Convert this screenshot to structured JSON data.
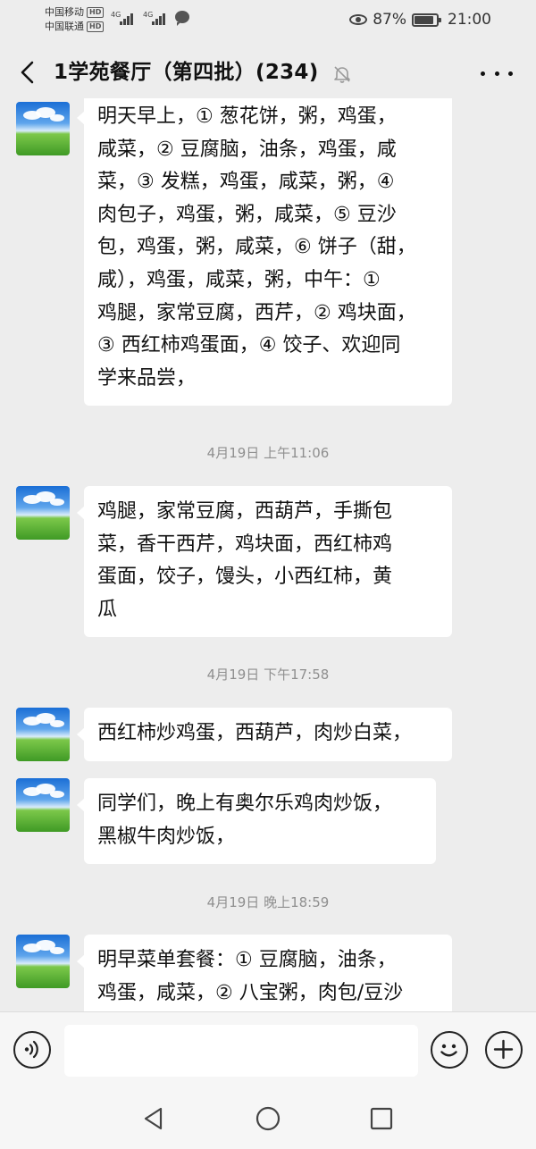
{
  "status_bar": {
    "carrier1": "中国移动",
    "carrier2": "中国联通",
    "hd1": "HD",
    "hd2": "HD",
    "net1": "4G",
    "net2": "4G",
    "battery_percent": "87%",
    "time": "21:00",
    "battery_level": 0.87
  },
  "header": {
    "title": "1学苑餐厅（第四批）(234)"
  },
  "messages": [
    {
      "type": "message",
      "lines": [
        "明天早上，① 葱花饼，粥，鸡蛋，",
        "咸菜，② 豆腐脑，油条，鸡蛋，咸",
        "菜，③ 发糕，鸡蛋，咸菜，粥，④",
        "肉包子，鸡蛋，粥，咸菜，⑤ 豆沙",
        "包，鸡蛋，粥，咸菜，⑥ 饼子（甜，",
        "咸），鸡蛋，咸菜，粥，中午：①",
        "鸡腿，家常豆腐，西芹，② 鸡块面，",
        "③ 西红柿鸡蛋面，④ 饺子、欢迎同",
        "学来品尝，"
      ]
    },
    {
      "type": "time",
      "text": "4月19日 上午11:06"
    },
    {
      "type": "message",
      "lines": [
        "鸡腿，家常豆腐，西葫芦，手撕包",
        "菜，香干西芹，鸡块面，西红柿鸡",
        "蛋面，饺子，馒头，小西红柿，黄",
        "瓜"
      ]
    },
    {
      "type": "time",
      "text": "4月19日 下午17:58"
    },
    {
      "type": "message",
      "lines": [
        "西红柿炒鸡蛋，西葫芦，肉炒白菜，"
      ]
    },
    {
      "type": "message",
      "lines": [
        "同学们，晚上有奥尔乐鸡肉炒饭，",
        "黑椒牛肉炒饭，"
      ]
    },
    {
      "type": "time",
      "text": "4月19日 晚上18:59"
    },
    {
      "type": "message",
      "lines": [
        "明早菜单套餐：① 豆腐脑，油条，",
        "鸡蛋，咸菜，② 八宝粥，肉包/豆沙"
      ]
    }
  ],
  "input": {
    "value": "",
    "placeholder": ""
  },
  "icons": {
    "back": "chevron-left-icon",
    "mute": "bell-off-icon",
    "more": "more-dots-icon",
    "voice": "voice-icon",
    "emoji": "smiley-icon",
    "plus": "plus-icon",
    "nav_back": "triangle-back-icon",
    "nav_home": "circle-home-icon",
    "nav_recent": "square-recent-icon"
  }
}
